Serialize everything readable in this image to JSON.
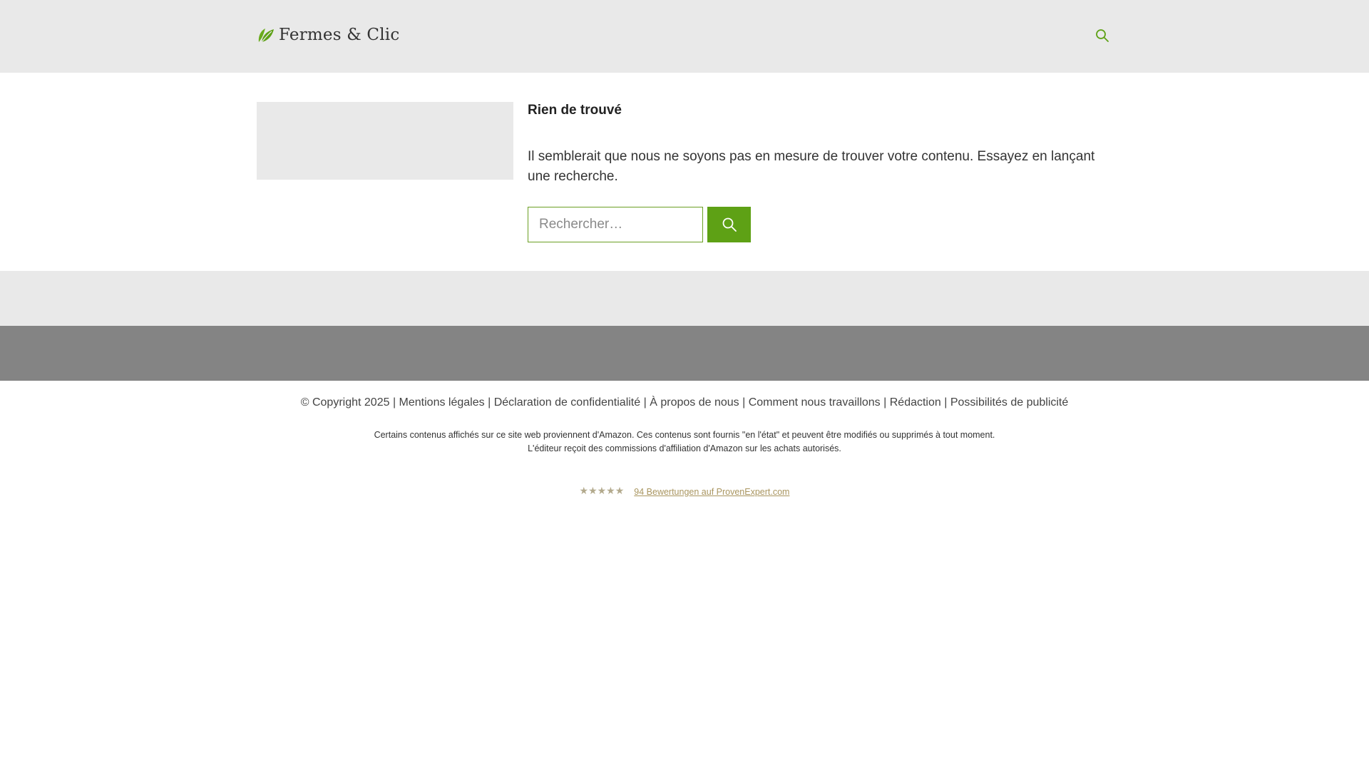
{
  "header": {
    "logo_text": "Fermes & Clic",
    "logo_icon": "leaf-icon",
    "search_icon": "search-icon"
  },
  "main": {
    "heading": "Rien de trouvé",
    "message": "Il semblerait que nous ne soyons pas en mesure de trouver votre contenu. Essayez en lançant une recherche.",
    "search": {
      "placeholder": "Rechercher…",
      "value": "",
      "button_icon": "search-icon"
    }
  },
  "footer": {
    "copyright": "© Copyright 2025",
    "links": [
      "Mentions légales",
      "Déclaration de confidentialité",
      "À propos de nous",
      "Comment nous travaillons",
      "Rédaction",
      "Possibilités de publicité"
    ],
    "separator": "|",
    "disclaimer_line1": "Certains contenus affichés sur ce site web proviennent d'Amazon. Ces contenus sont fournis \"en l'état\" et peuvent être modifiés ou supprimés à tout moment.",
    "disclaimer_line2": "L'éditeur reçoit des commissions d'affiliation d'Amazon sur les achats autorisés.",
    "rating_stars": "★★★★★",
    "rating_text": "94 Bewertungen auf ProvenExpert.com"
  },
  "colors": {
    "accent": "#5ea115",
    "header_bg": "#e9e9e9",
    "band_dark": "#848484",
    "rating_link": "#a9955f"
  }
}
